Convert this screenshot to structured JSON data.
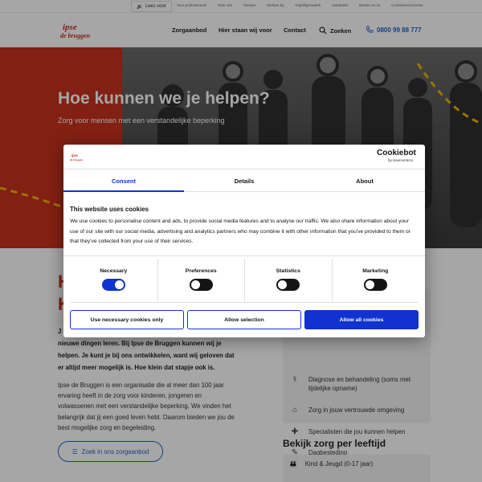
{
  "topbar": {
    "readspeaker_label": "Lees voor",
    "links": [
      "Voor professionals",
      "Over ons",
      "Nieuws",
      "Werken bij",
      "Vrijwilligerswerk",
      "Jaarbeeld",
      "Wonen en zo",
      "CookiesenzoCenter"
    ]
  },
  "header": {
    "logo_text_top": "ipse",
    "logo_text_bottom": "de bruggen",
    "nav": {
      "zorgaanbod": "Zorgaanbod",
      "hier_staan": "Hier staan wij voor",
      "contact": "Contact",
      "zoeken": "Zoeken"
    },
    "phone": "0800 99 88 777"
  },
  "hero": {
    "title": "Hoe kunnen we je helpen?",
    "subtitle": "Zorg voor mensen met een verstandelijke beperking"
  },
  "content": {
    "title_line1": "H",
    "title_line2": "K",
    "lead_prefix": "J",
    "lead": "nieuwe dingen leren. Bij Ipse de Bruggen kunnen wij je helpen. Je kunt je bij ons ontwikkelen, want wij geloven dat er altijd meer mogelijk is. Hoe klein dat stapje ook is.",
    "body": "Ipse de Bruggen is een organisatie die al meer dan 100 jaar ervaring heeft in de zorg voor kinderen, jongeren en volwassenen met een verstandelijke beperking. We vinden het belangrijk dat jij een goed leven hebt. Daarom bieden we jou de best mogelijke zorg en begeleiding.",
    "zoek_button": "Zoek in ons zorgaanbod",
    "services": [
      "Diagnose en behandeling (soms met tijdelijke opname)",
      "Zorg in jouw vertrouwde omgeving",
      "Specialisten die jou kunnen helpen",
      "Dagbesteding"
    ],
    "leeftijd_title": "Bekijk zorg per leeftijd",
    "leeftijd_items": [
      "Kind & Jeugd (0-17 jaar)"
    ]
  },
  "cookie_dialog": {
    "brand": "Cookiebot",
    "brand_sub": "by Usercentrics",
    "tabs": [
      "Consent",
      "Details",
      "About"
    ],
    "active_tab": "Consent",
    "title": "This website uses cookies",
    "text": "We use cookies to personalise content and ads, to provide social media features and to analyse our traffic. We also share information about your use of our site with our social media, advertising and analytics partners who may combine it with other information that you've provided to them or that they've collected from your use of their services.",
    "toggles": [
      {
        "label": "Necessary",
        "on": true
      },
      {
        "label": "Preferences",
        "on": false
      },
      {
        "label": "Statistics",
        "on": false
      },
      {
        "label": "Marketing",
        "on": false
      }
    ],
    "buttons": {
      "necessary_only": "Use necessary cookies only",
      "allow_selection": "Allow selection",
      "allow_all": "Allow all cookies"
    },
    "accent_color": "#1032cf"
  },
  "colors": {
    "brand_red": "#c8321e",
    "link_blue": "#1e64c8"
  }
}
